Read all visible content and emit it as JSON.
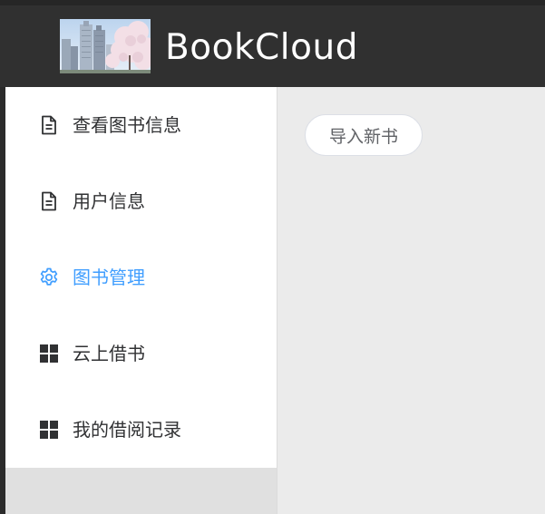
{
  "header": {
    "title": "BookCloud",
    "logo_icon": "city-blossom-photo-logo"
  },
  "sidebar": {
    "active_color": "#409eff",
    "items": [
      {
        "label": "查看图书信息",
        "icon": "document-icon",
        "active": false
      },
      {
        "label": "用户信息",
        "icon": "document-icon",
        "active": false
      },
      {
        "label": "图书管理",
        "icon": "gear-icon",
        "active": true
      },
      {
        "label": "云上借书",
        "icon": "grid-icon",
        "active": false
      },
      {
        "label": "我的借阅记录",
        "icon": "grid-icon",
        "active": false
      }
    ]
  },
  "main": {
    "import_button_label": "导入新书"
  }
}
